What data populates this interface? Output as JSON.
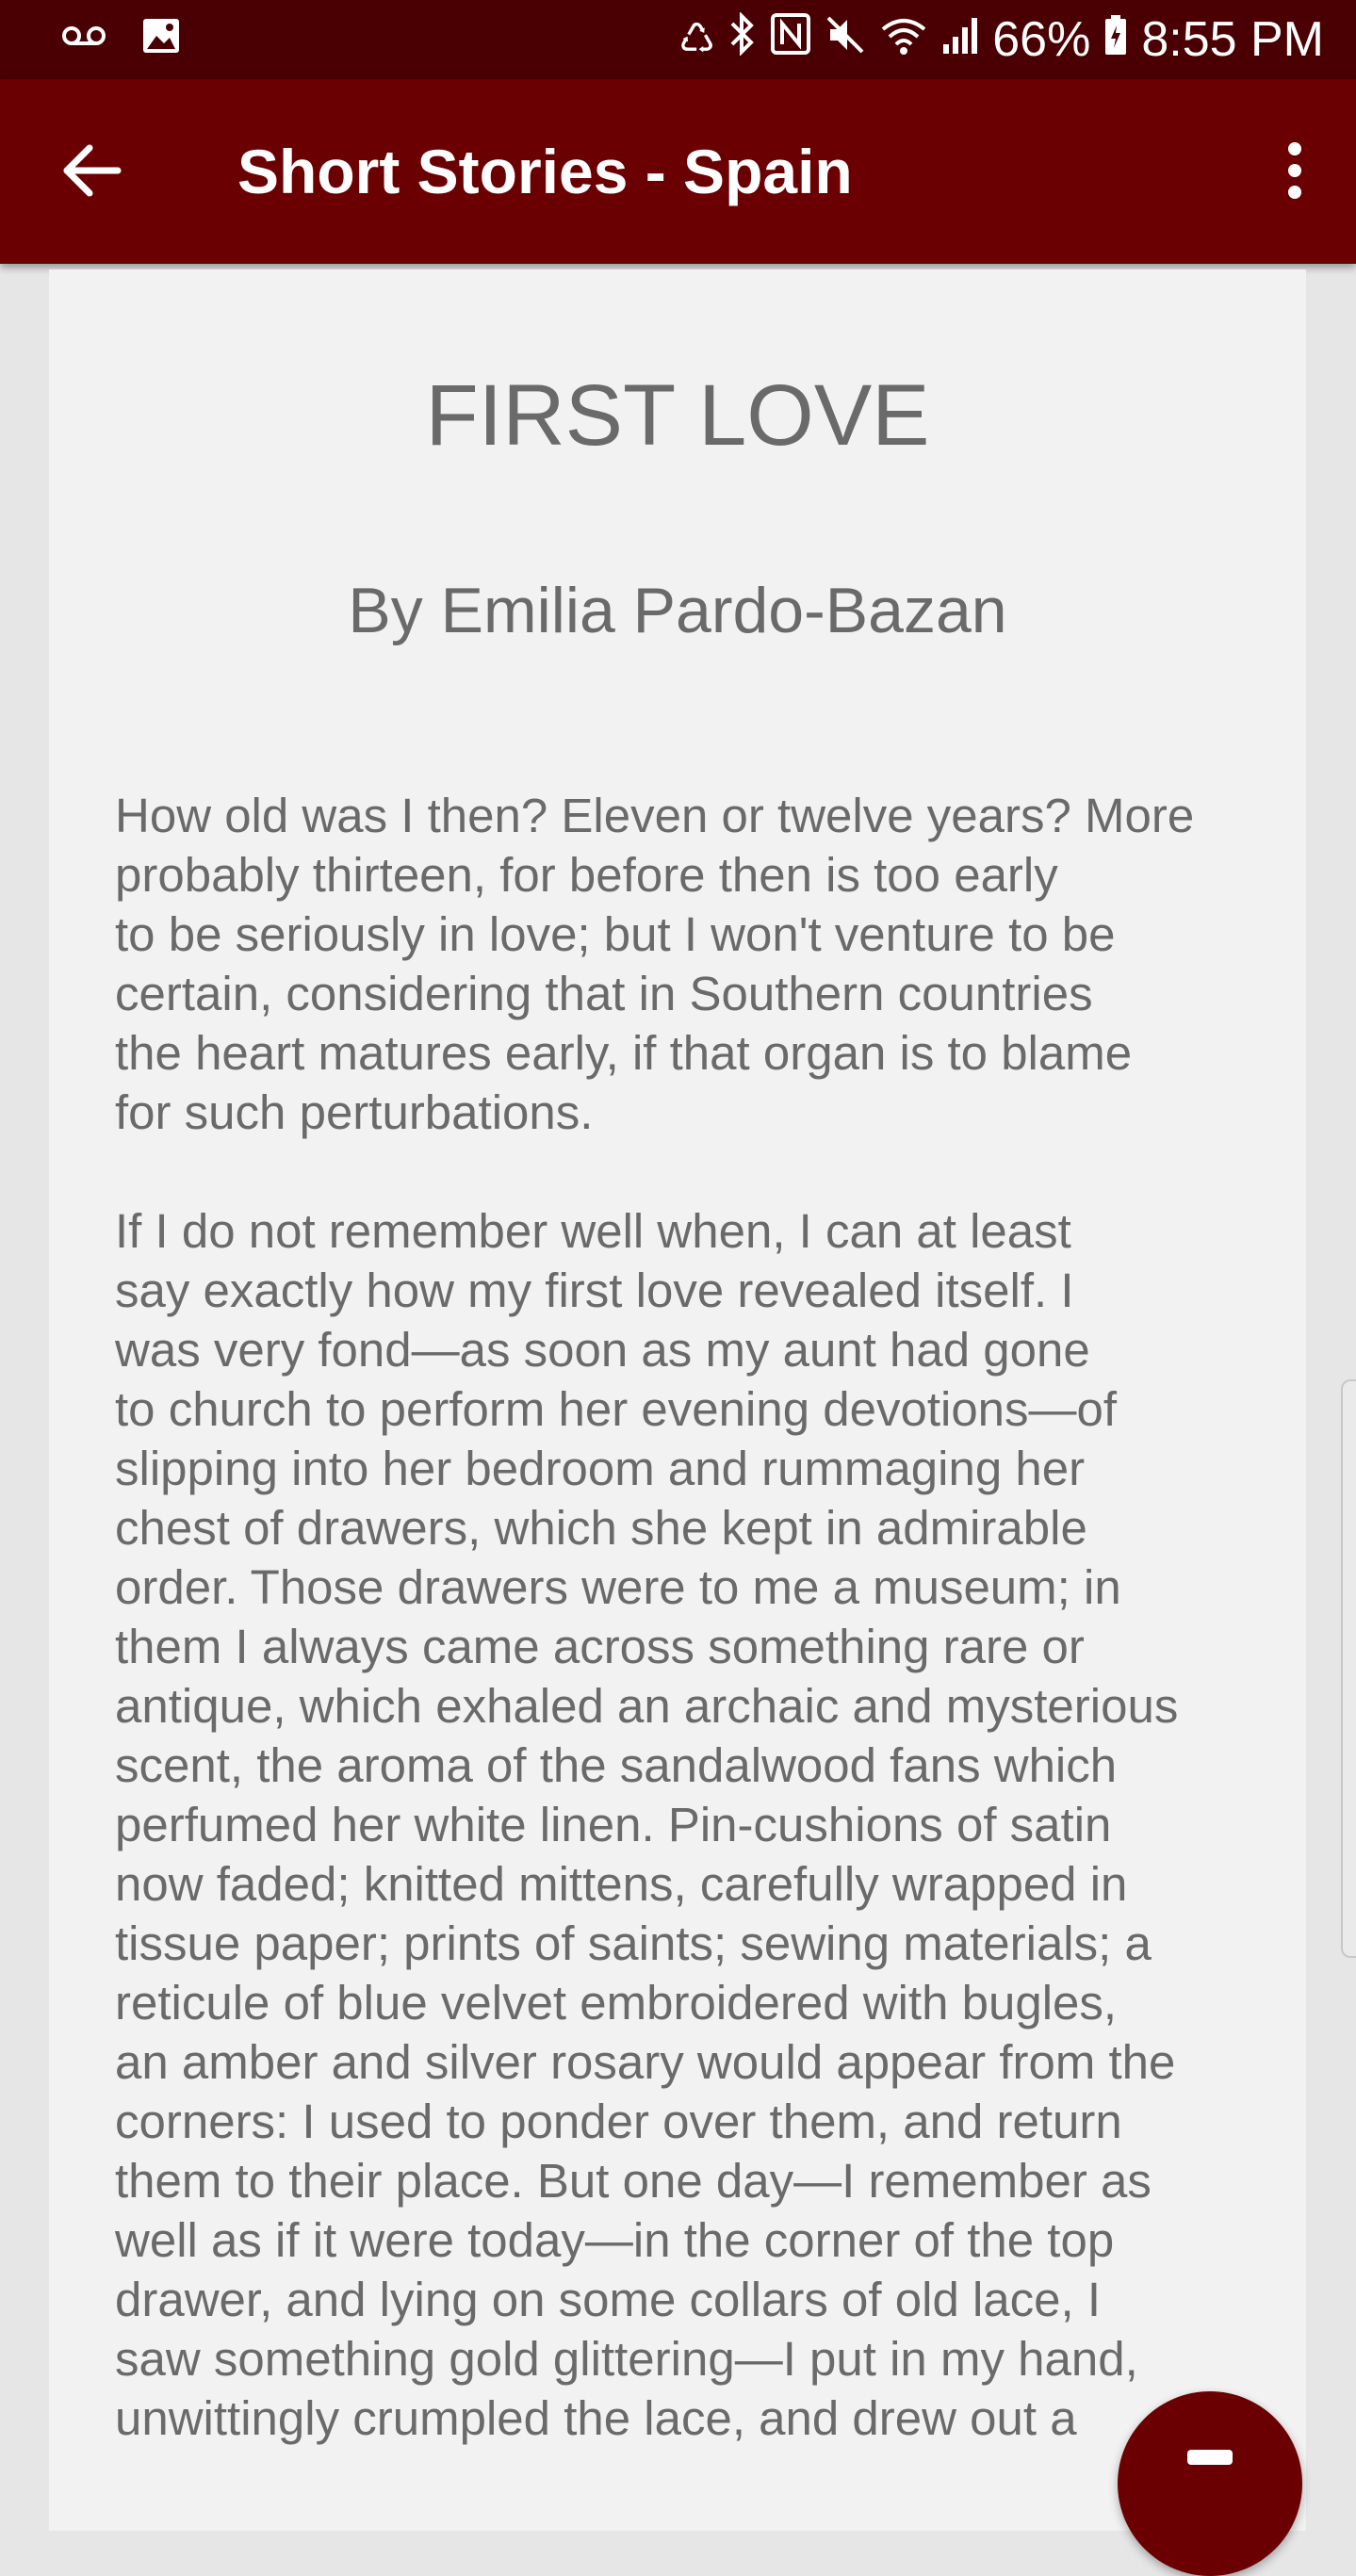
{
  "status_bar": {
    "battery": "66%",
    "time": "8:55 PM",
    "icons": [
      "voicemail-icon",
      "image-icon",
      "recycle-icon",
      "bluetooth-icon",
      "nfc-icon",
      "mute-icon",
      "wifi-icon",
      "signal-icon",
      "battery-icon"
    ]
  },
  "app_bar": {
    "title": "Short Stories - Spain",
    "back_icon": "arrow-left-icon",
    "menu_icon": "more-vert-icon",
    "background": "#6b0003"
  },
  "story": {
    "title": "FIRST LOVE",
    "author": "By Emilia Pardo-Bazan",
    "paragraphs": [
      {
        "lines": [
          "How old was I then? Eleven or twelve years? More",
          "probably thirteen, for before then is too early",
          "to be seriously in love; but I won't venture to be",
          "certain, considering that in Southern countries",
          "the heart matures early, if that organ is to blame",
          "for such perturbations."
        ]
      },
      {
        "lines": [
          "If I do not remember well when, I can at least",
          "say exactly how my first love revealed itself. I",
          "was very fond—as soon as my aunt had gone",
          "to church to perform her evening devotions—of",
          "slipping into her bedroom and rummaging her",
          "chest of drawers, which she kept in admirable",
          "order. Those drawers were to me a museum; in",
          "them I always came across something rare or",
          "antique, which exhaled an archaic and mysterious",
          "scent, the aroma of the sandalwood fans which",
          "perfumed her white linen. Pin-cushions of satin",
          "now faded; knitted mittens, carefully wrapped in",
          "tissue paper; prints of saints; sewing materials; a",
          "reticule of blue velvet embroidered with bugles,",
          "an amber and silver rosary would appear from the",
          "corners: I used to ponder over them, and return",
          "them to their place. But one day—I remember as",
          "well as if it were today—in the corner of the top",
          "drawer, and lying on some collars of old lace, I",
          "saw something gold glittering—I put in my hand,",
          "unwittingly crumpled the lace, and drew out a"
        ]
      }
    ]
  },
  "fab": {
    "icon": "note-icon"
  }
}
